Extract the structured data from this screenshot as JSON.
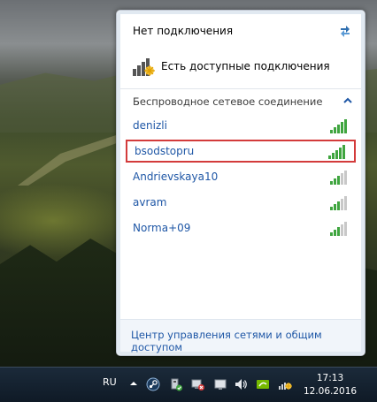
{
  "popup": {
    "status_title": "Нет подключения",
    "status_line": "Есть доступные подключения",
    "section_header": "Беспроводное сетевое соединение",
    "networks": [
      {
        "name": "denizli",
        "signal": 5,
        "highlighted": false
      },
      {
        "name": "bsodstopru",
        "signal": 5,
        "highlighted": true
      },
      {
        "name": "Andrievskaya10",
        "signal": 3,
        "highlighted": false
      },
      {
        "name": "avram",
        "signal": 3,
        "highlighted": false
      },
      {
        "name": "Norma+09",
        "signal": 3,
        "highlighted": false
      }
    ],
    "footer_link": "Центр управления сетями и общим доступом"
  },
  "taskbar": {
    "language": "RU",
    "tray_icons": [
      "show-hidden-icons",
      "steam-icon",
      "usb-device-icon",
      "network-icon",
      "volume-icon",
      "nvidia-icon",
      "network-no-connection-icon"
    ],
    "clock_time": "17:13",
    "clock_date": "12.06.2016"
  },
  "colors": {
    "link": "#1f57a6",
    "highlight_border": "#d33b3b",
    "signal_on": "#3fa53f",
    "signal_off": "#c8c8c8"
  }
}
